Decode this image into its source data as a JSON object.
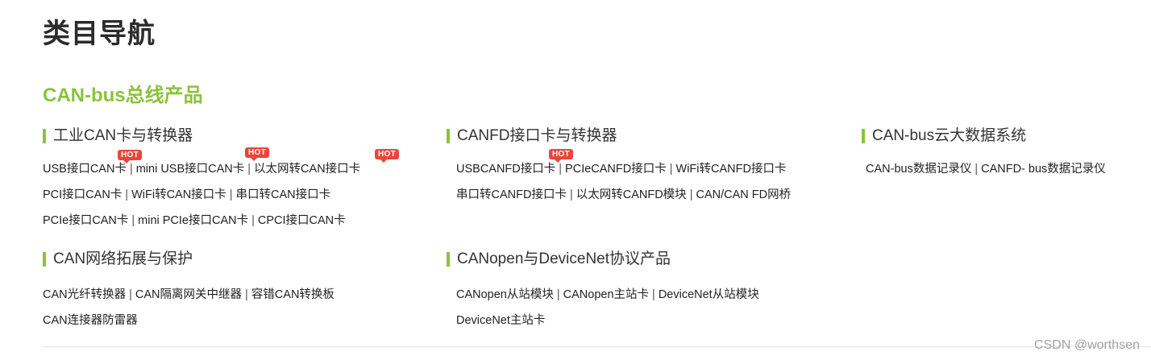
{
  "page": {
    "title": "类目导航",
    "section_title": "CAN-bus总线产品",
    "watermark": "CSDN @worthsen"
  },
  "hot_badge_label": "HOT",
  "categories": {
    "industrial_can": {
      "heading": "工业CAN卡与转换器",
      "lines": [
        [
          "USB接口CAN卡",
          "mini USB接口CAN卡",
          "以太网转CAN接口卡"
        ],
        [
          "PCI接口CAN卡",
          "WiFi转CAN接口卡",
          "串口转CAN接口卡"
        ],
        [
          "PCIe接口CAN卡",
          "mini PCIe接口CAN卡",
          "CPCI接口CAN卡"
        ]
      ]
    },
    "canfd": {
      "heading": "CANFD接口卡与转换器",
      "lines": [
        [
          "USBCANFD接口卡",
          "PCIeCANFD接口卡",
          "WiFi转CANFD接口卡"
        ],
        [
          "串口转CANFD接口卡",
          "以太网转CANFD模块",
          "CAN/CAN FD网桥"
        ]
      ]
    },
    "cloud": {
      "heading": "CAN-bus云大数据系统",
      "lines": [
        [
          "CAN-bus数据记录仪",
          "CANFD- bus数据记录仪"
        ]
      ]
    },
    "network": {
      "heading": "CAN网络拓展与保护",
      "lines": [
        [
          "CAN光纤转换器",
          "CAN隔离网关中继器",
          "容错CAN转换板"
        ],
        [
          "CAN连接器防雷器"
        ]
      ]
    },
    "canopen": {
      "heading": "CANopen与DeviceNet协议产品",
      "lines": [
        [
          "CANopen从站模块",
          "CANopen主站卡",
          "DeviceNet从站模块"
        ],
        [
          "DeviceNet主站卡"
        ]
      ]
    }
  },
  "separator": "|",
  "colors": {
    "accent_green": "#8ac33a",
    "hot_red": "#e8463b"
  }
}
